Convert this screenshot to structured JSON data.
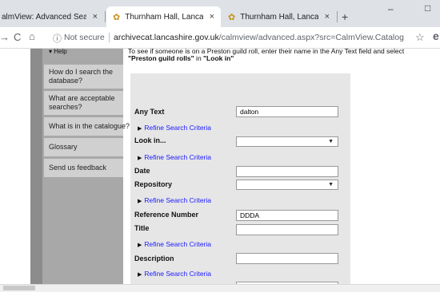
{
  "browser": {
    "tabs": [
      {
        "label": "almView: Advanced Search",
        "active": false
      },
      {
        "label": "Thurnham Hall, Lancashire, Engl",
        "active": true
      },
      {
        "label": "Thurnham Hall, Lancashire, Engl",
        "active": false
      }
    ],
    "new_tab": "+",
    "close_glyph": "×",
    "tab_icon_glyph": "✿",
    "window_controls": {
      "minimize": "–",
      "maximize": "□"
    },
    "nav": {
      "back": "→",
      "reload": "C",
      "home": "⌂",
      "info": "ⓘ",
      "star": "☆",
      "profile": "e"
    },
    "address": {
      "security": "Not secure",
      "host": "archivecat.lancashire.gov.uk",
      "path": "/calmview/advanced.aspx?src=CalmView.Catalog"
    }
  },
  "sidebar": {
    "heading": "▾ Help",
    "items": [
      "How do I search the database?",
      "What are acceptable searches?",
      "What is in the catalogue?",
      "Glossary",
      "Send us feedback"
    ]
  },
  "intro": {
    "line1": "To see if someone is on a Preston guild roll, enter their name in the Any Text field and select",
    "line2_bold": "\"Preston guild rolls\"",
    "line2_mid": " in ",
    "line2_bold2": "\"Look in\""
  },
  "form": {
    "any_text": {
      "label": "Any Text",
      "value": "dalton"
    },
    "refine_label": "Refine Search Criteria",
    "refine_glyph": "▶",
    "dropdown_arrow": "▼",
    "look_in": {
      "label": "Look in..."
    },
    "date": {
      "label": "Date"
    },
    "repository": {
      "label": "Repository"
    },
    "reference_number": {
      "label": "Reference Number",
      "value": "DDDA"
    },
    "title": {
      "label": "Title"
    },
    "description": {
      "label": "Description"
    }
  },
  "colors": {
    "link": "#1a1aff",
    "sidebar_bg": "#a8a8a8",
    "sidebar_item_bg": "#d0d0d0",
    "form_bg": "#e6e6e6",
    "chrome_bg": "#dee1e6"
  }
}
